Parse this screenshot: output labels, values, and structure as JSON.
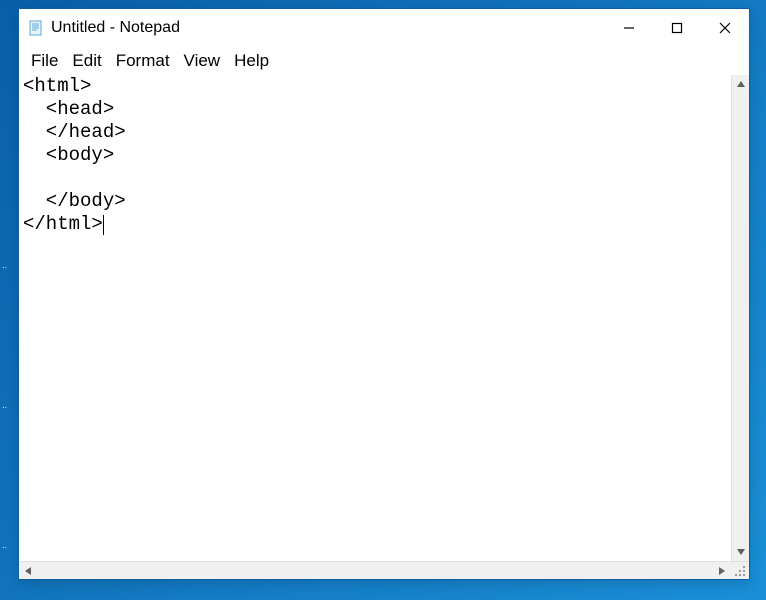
{
  "window": {
    "title": "Untitled - Notepad"
  },
  "menubar": {
    "items": [
      "File",
      "Edit",
      "Format",
      "View",
      "Help"
    ]
  },
  "editor": {
    "content": "<html>\n  <head>\n  </head>\n  <body>\n\n  </body>\n</html>"
  }
}
